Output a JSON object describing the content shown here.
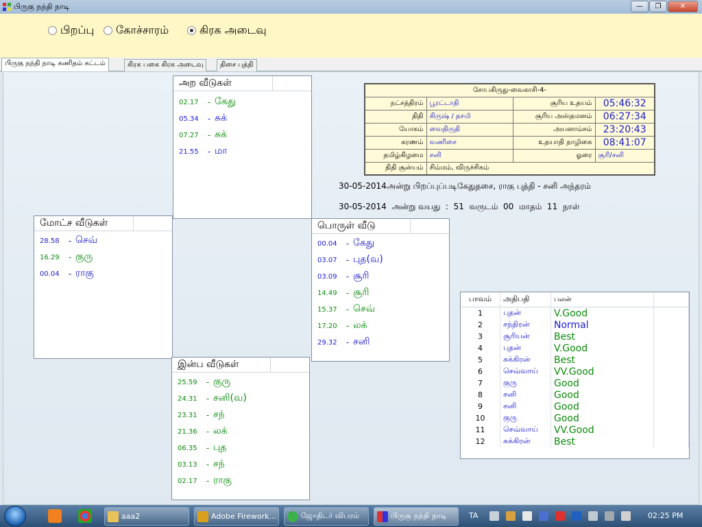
{
  "window": {
    "title": "பிருகு நந்தி நாடி"
  },
  "radios": [
    {
      "label": "பிறப்பு",
      "checked": false
    },
    {
      "label": "கோச்சாரம்",
      "checked": false
    },
    {
      "label": "கிரக அடைவு",
      "checked": true
    }
  ],
  "tabs": [
    {
      "label": "பிருகு நந்தி நாடி கணிதம் கட்டம்"
    },
    {
      "label": "கிரக பகை கிரக அடைவு"
    },
    {
      "label": "திசை புத்தி"
    }
  ],
  "ara": {
    "title": "அற வீடுகள்",
    "rows": [
      {
        "deg": "02.17",
        "planet": "கேது",
        "color": "green"
      },
      {
        "deg": "05.34",
        "planet": "சுக்",
        "color": "blue"
      },
      {
        "deg": "07.27",
        "planet": "சுக்",
        "color": "green"
      },
      {
        "deg": "21.55",
        "planet": "மா",
        "color": "blue"
      }
    ]
  },
  "moksha": {
    "title": "மோட்ச வீடுகள்",
    "rows": [
      {
        "deg": "28.58",
        "planet": "செவ்",
        "color": "blue"
      },
      {
        "deg": "16.29",
        "planet": "குரு",
        "color": "green"
      },
      {
        "deg": "00.04",
        "planet": "ராகு",
        "color": "blue"
      }
    ]
  },
  "porul": {
    "title": "பொருள் வீடு",
    "rows": [
      {
        "deg": "00.04",
        "planet": "கேது",
        "color": "blue"
      },
      {
        "deg": "03.07",
        "planet": "புத(வ)",
        "color": "blue"
      },
      {
        "deg": "03.09",
        "planet": "சூரி",
        "color": "blue"
      },
      {
        "deg": "14.49",
        "planet": "சூரி",
        "color": "green"
      },
      {
        "deg": "15.37",
        "planet": "செவ்",
        "color": "green"
      },
      {
        "deg": "17.20",
        "planet": "லக்",
        "color": "green"
      },
      {
        "deg": "29.32",
        "planet": "சனி",
        "color": "blue"
      }
    ]
  },
  "inba": {
    "title": "இன்ப வீடுகள்",
    "rows": [
      {
        "deg": "25.59",
        "planet": "குரு",
        "color": "green"
      },
      {
        "deg": "24.31",
        "planet": "சனி(வ)",
        "color": "green"
      },
      {
        "deg": "23.31",
        "planet": "சந்",
        "color": "green"
      },
      {
        "deg": "21.36",
        "planet": "லக்",
        "color": "green"
      },
      {
        "deg": "06.35",
        "planet": "புத",
        "color": "green"
      },
      {
        "deg": "03.13",
        "planet": "சந்",
        "color": "green"
      },
      {
        "deg": "02.17",
        "planet": "ராகு",
        "color": "green"
      }
    ]
  },
  "info": {
    "header": "சோபகிருது-வைகாசி-4-",
    "nakshatra_label": "நட்சத்திரம்",
    "nakshatra": "பூரட்டாதி",
    "sunrise_label": "சூரிய உதயம்",
    "sunrise": "05:46:32",
    "tithi_label": "திதி",
    "tithi": "கிருஷ் / தசமி",
    "sunset_label": "சூரிய அஸ்தமனம்",
    "sunset": "06:27:34",
    "yogam_label": "யோகம்",
    "yogam": "வைதிருதி",
    "ayanamsa_label": "அயனாம்சம்",
    "ayanamsa": "23:20:43",
    "karanam_label": "கரணம்",
    "karanam": "வணிசை",
    "udayadi_label": "உதயாதி நாழிகை",
    "udayadi": "08:41:07",
    "weekday_label": "தமிழ்கிழமை",
    "weekday": "சனி",
    "hora_label": "ஓரை",
    "hora": "சூரி/சனி",
    "tithi_sunya_label": "திதி சூன்யம்",
    "tithi_sunya": "சிம்மம், விருச்சிகம்"
  },
  "dasa": {
    "line1": "30-05-2014அன்று பிறப்புப்படிகேதுதசை, ராகு புத்தி - சனி அந்தரம்",
    "line2": "30-05-2014  அன்று வயது  :  51  வருடம்  00  மாதம்  11  நாள்"
  },
  "bhava": {
    "headers": [
      "பாவம்",
      "அதிபதி",
      "பலன்"
    ],
    "rows": [
      {
        "num": "1",
        "lord": "புதன்",
        "result": "V.Good",
        "color": "green"
      },
      {
        "num": "2",
        "lord": "சந்திரன்",
        "result": "Normal",
        "color": "blue"
      },
      {
        "num": "3",
        "lord": "சூரியன்",
        "result": "Best",
        "color": "green"
      },
      {
        "num": "4",
        "lord": "புதன்",
        "result": "V.Good",
        "color": "green"
      },
      {
        "num": "5",
        "lord": "சுக்கிரன்",
        "result": "Best",
        "color": "green"
      },
      {
        "num": "6",
        "lord": "செவ்வாய்",
        "result": "VV.Good",
        "color": "green"
      },
      {
        "num": "7",
        "lord": "குரு",
        "result": "Good",
        "color": "green"
      },
      {
        "num": "8",
        "lord": "சனி",
        "result": "Good",
        "color": "green"
      },
      {
        "num": "9",
        "lord": "சனி",
        "result": "Good",
        "color": "green"
      },
      {
        "num": "10",
        "lord": "குரு",
        "result": "Good",
        "color": "green"
      },
      {
        "num": "11",
        "lord": "செவ்வாய்",
        "result": "VV.Good",
        "color": "green"
      },
      {
        "num": "12",
        "lord": "சுக்கிரன்",
        "result": "Best",
        "color": "green"
      }
    ]
  },
  "taskbar": {
    "tasks": [
      {
        "label": "aaa2"
      },
      {
        "label": "Adobe Firework..."
      },
      {
        "label": "ஜோதிடர் விபரம்"
      },
      {
        "label": "பிருகு நந்தி நாடி"
      }
    ],
    "lang": "TA",
    "clock": "02:25 PM"
  },
  "colors": {
    "green": "#0a8a0a",
    "blue": "#1a1ad0"
  }
}
